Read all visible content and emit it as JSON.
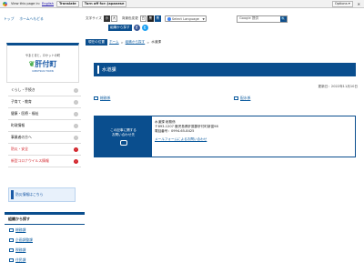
{
  "translate_bar": {
    "text": "View this page in:",
    "language": "English",
    "translate_label": "Translate",
    "turn_off": "Turn off for: Japanese",
    "options_label": "Options ▾",
    "close": "✕"
  },
  "header": {
    "home_links": [
      "トップ",
      "ホームへもどる"
    ],
    "text_size_label": "文字サイズ",
    "text_size_small": "小",
    "text_size_large": "大",
    "bg_color_label": "背景色変更",
    "bg_white": "白",
    "bg_black": "黒",
    "bg_blue": "青",
    "language_select": "Select Language",
    "search_placeholder": "Google 提供",
    "search_button": "🔍",
    "sitemap_label": "組織から探す",
    "fb": "f",
    "tw": "t"
  },
  "logo": {
    "tagline": "やまと青と、ロケットの町",
    "name": "肝付町",
    "sub": "KIMOTSUKI TOWN"
  },
  "left_nav": [
    {
      "label": "くらし・手続き",
      "alert": false
    },
    {
      "label": "子育て・教育",
      "alert": false
    },
    {
      "label": "健康・医療・福祉",
      "alert": false
    },
    {
      "label": "町政情報",
      "alert": false
    },
    {
      "label": "事業者の方へ",
      "alert": false
    },
    {
      "label": "防災・安全",
      "alert": true
    },
    {
      "label": "新型コロナウイルス情報",
      "alert": true
    }
  ],
  "disaster_label": "防災情報はこちら",
  "breadcrumb": [
    "現在の位置",
    "ホーム",
    "組織から探す",
    "水道課"
  ],
  "page": {
    "title": "水道課",
    "updated": "更新日：2022年11月10日",
    "links": [
      "総務係",
      "配水係"
    ]
  },
  "contact": {
    "lhs": "この記事に関する\nお問い合わせ先",
    "lines": [
      "水道課 総務係",
      "〒893-1207 鹿児島県肝属郡肝付町新富98",
      "電話番号：0994-65-8425"
    ],
    "mail_link": "メールフォームによるお問い合わせ"
  },
  "org": {
    "heading": "組織から探す",
    "items": [
      "総務課",
      "企画調整課",
      "税務課",
      "住民課"
    ]
  }
}
